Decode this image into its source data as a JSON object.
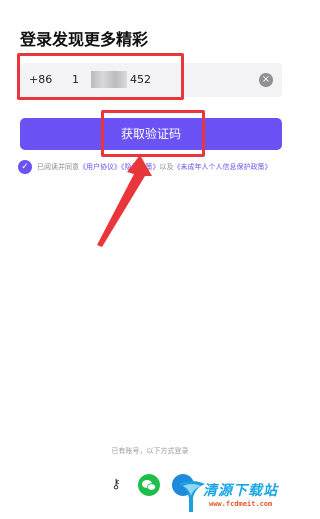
{
  "header": {
    "title": "登录发现更多精彩"
  },
  "phone": {
    "country_code": "+86",
    "prefix": "1",
    "suffix": "452"
  },
  "actions": {
    "get_code_label": "获取验证码"
  },
  "agreement": {
    "prefix": "已阅读并同意",
    "user_agreement": "《用户协议》",
    "privacy_policy": "《隐私政策》",
    "joiner": "以及",
    "minor_policy": "《未成年人个人信息保护政策》"
  },
  "other_login": {
    "label": "已有账号，以下方式登录",
    "icons": [
      "key-icon",
      "wechat-icon",
      "qq-icon"
    ]
  },
  "watermark": {
    "title": "清源下载站",
    "url": "www.fcdmeit.com"
  },
  "colors": {
    "accent": "#6a52f5",
    "annotation_red": "#e8363b",
    "wechat_green": "#1dbf4a"
  }
}
